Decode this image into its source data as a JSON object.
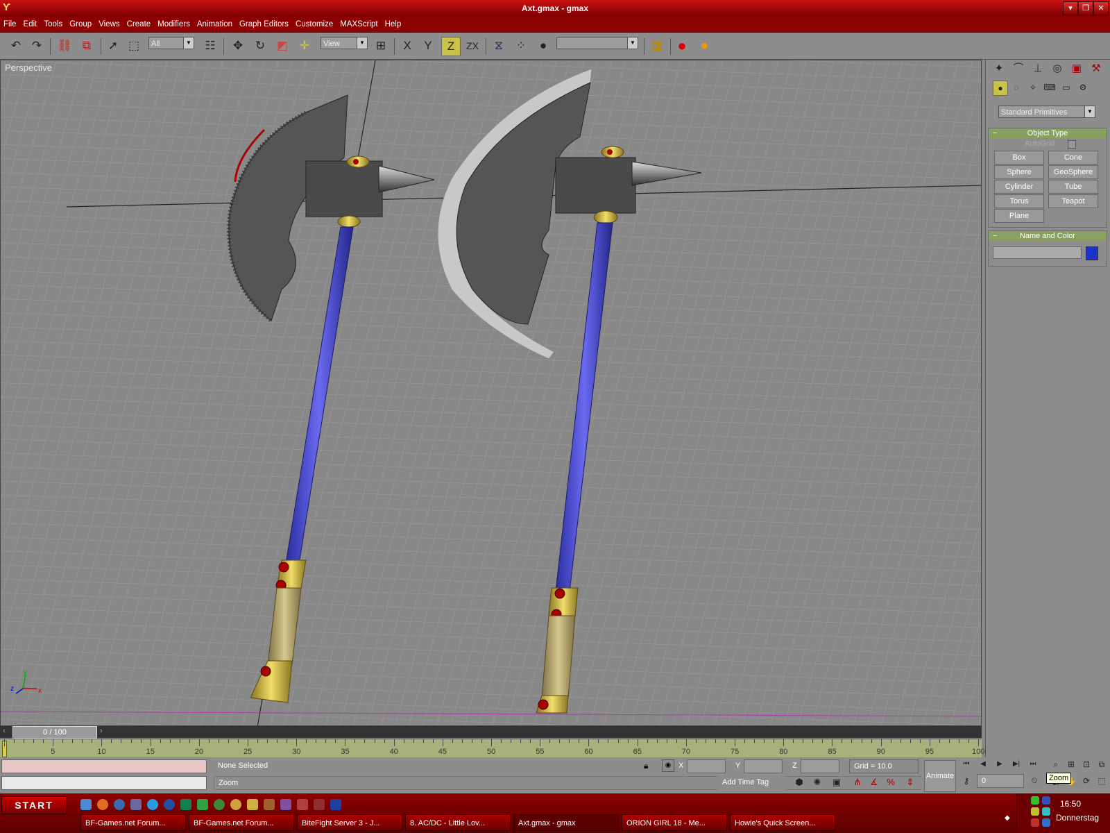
{
  "window": {
    "title": "Axt.gmax - gmax"
  },
  "menu": [
    "File",
    "Edit",
    "Tools",
    "Group",
    "Views",
    "Create",
    "Modifiers",
    "Animation",
    "Graph Editors",
    "Customize",
    "MAXScript",
    "Help"
  ],
  "toolbar": {
    "selection_filter": "All",
    "ref_coord": "View",
    "constraint_x": "X",
    "constraint_y": "Y",
    "constraint_z": "Z",
    "constraint_zx": "ZX",
    "named_selection": ""
  },
  "viewport": {
    "label": "Perspective",
    "axis_x": "x",
    "axis_y": "y",
    "axis_z": "z"
  },
  "command_panel": {
    "category_dropdown": "Standard Primitives",
    "object_type": {
      "header": "Object Type",
      "autogrid_label": "AutoGrid",
      "buttons": [
        "Box",
        "Cone",
        "Sphere",
        "GeoSphere",
        "Cylinder",
        "Tube",
        "Torus",
        "Teapot",
        "Plane"
      ]
    },
    "name_and_color": {
      "header": "Name and Color",
      "name_value": "",
      "color": "#1a33cc"
    }
  },
  "timeline": {
    "slider_text": "0 / 100",
    "ticks": [
      "5",
      "10",
      "15",
      "20",
      "25",
      "30",
      "35",
      "40",
      "45",
      "50",
      "55",
      "60",
      "65",
      "70",
      "75",
      "80",
      "85",
      "90",
      "95",
      "100"
    ]
  },
  "status": {
    "selection": "None Selected",
    "prompt": "Zoom",
    "x_label": "X",
    "y_label": "Y",
    "z_label": "Z",
    "x_value": "",
    "y_value": "",
    "z_value": "",
    "grid": "Grid = 10.0",
    "add_time_tag": "Add Time Tag",
    "animate": "Animate",
    "frame": "0",
    "tooltip": "Zoom"
  },
  "taskbar": {
    "start": "START",
    "tasks": [
      "BF-Games.net Forum...",
      "BF-Games.net Forum...",
      "BiteFight Server 3 - J...",
      "8. AC/DC - Little Lov...",
      "Axt.gmax - gmax",
      "ORION GIRL 18 - Me...",
      "Howie's Quick Screen..."
    ],
    "time": "16:50",
    "day": "Donnerstag"
  }
}
